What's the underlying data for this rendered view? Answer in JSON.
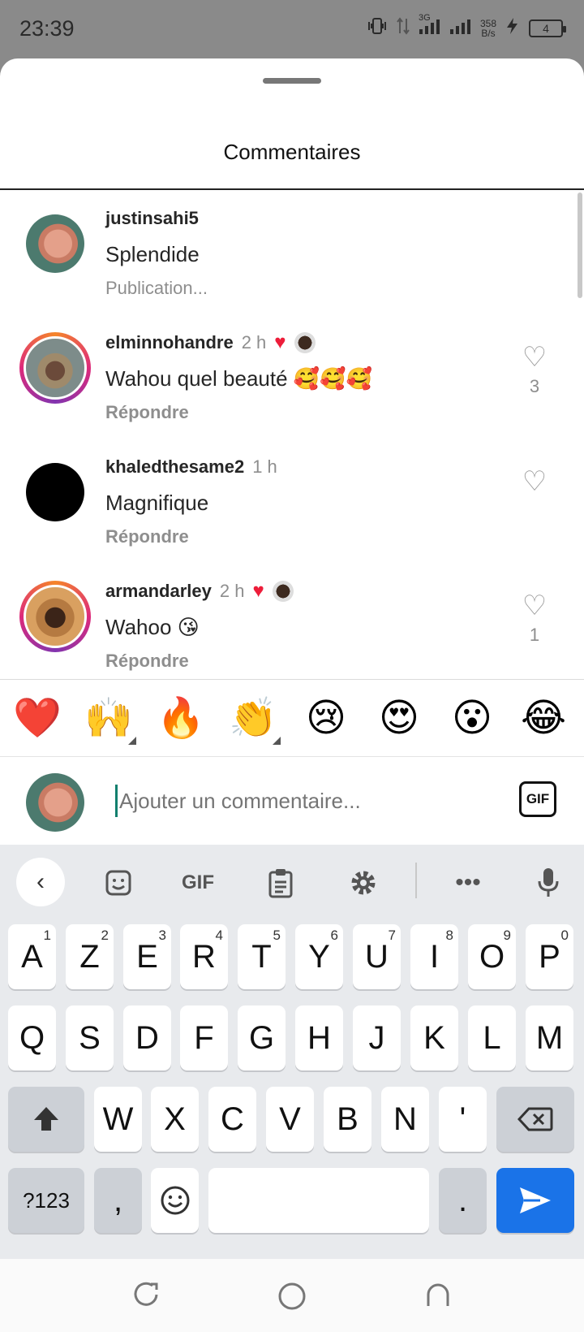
{
  "status_bar": {
    "time": "23:39",
    "network": "3G",
    "speed": "358",
    "speed_unit": "B/s",
    "battery": "4"
  },
  "sheet": {
    "title": "Commentaires"
  },
  "comments": [
    {
      "username": "justinsahi5",
      "time": "",
      "text": "Splendide",
      "meta": "Publication...",
      "likes": ""
    },
    {
      "username": "elminnohandre",
      "time": "2 h",
      "text": "Wahou quel beauté 🥰🥰🥰",
      "meta": "Répondre",
      "likes": "3"
    },
    {
      "username": "khaledthesame2",
      "time": "1 h",
      "text": "Magnifique",
      "meta": "Répondre",
      "likes": ""
    },
    {
      "username": "armandarley",
      "time": "2 h",
      "text": "Wahoo 😘",
      "meta": "Répondre",
      "likes": "1"
    }
  ],
  "emoji_bar": [
    "❤️",
    "🙌",
    "🔥",
    "👏",
    "😢",
    "😍",
    "😮",
    "😂"
  ],
  "composer": {
    "placeholder": "Ajouter un commentaire...",
    "gif_label": "GIF"
  },
  "keyboard": {
    "toolbar": {
      "gif": "GIF"
    },
    "row1": [
      {
        "k": "A",
        "h": "1"
      },
      {
        "k": "Z",
        "h": "2"
      },
      {
        "k": "E",
        "h": "3"
      },
      {
        "k": "R",
        "h": "4"
      },
      {
        "k": "T",
        "h": "5"
      },
      {
        "k": "Y",
        "h": "6"
      },
      {
        "k": "U",
        "h": "7"
      },
      {
        "k": "I",
        "h": "8"
      },
      {
        "k": "O",
        "h": "9"
      },
      {
        "k": "P",
        "h": "0"
      }
    ],
    "row2": [
      "Q",
      "S",
      "D",
      "F",
      "G",
      "H",
      "J",
      "K",
      "L",
      "M"
    ],
    "row3": [
      "W",
      "X",
      "C",
      "V",
      "B",
      "N",
      "'"
    ],
    "symbols_label": "?123",
    "comma": ",",
    "period": "."
  }
}
